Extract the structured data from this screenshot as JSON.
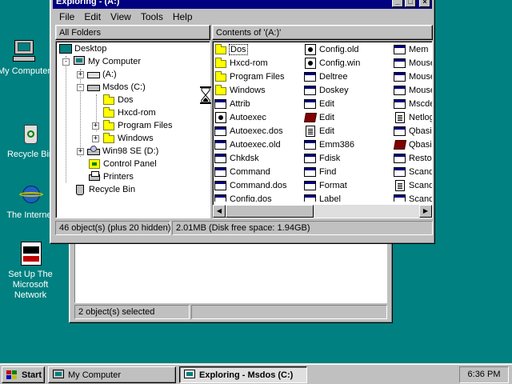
{
  "desktop": {
    "icons": [
      {
        "label": "My Computer",
        "icon": "my-computer-icon"
      },
      {
        "label": "Recycle Bin",
        "icon": "recycle-bin-icon"
      },
      {
        "label": "The Internet",
        "icon": "internet-explorer-icon"
      },
      {
        "label": "Set Up The Microsoft Network",
        "icon": "msn-icon"
      }
    ]
  },
  "explorer": {
    "title": "Exploring - (A:)",
    "menu": [
      "File",
      "Edit",
      "View",
      "Tools",
      "Help"
    ],
    "left_header": "All Folders",
    "right_header": "Contents of '(A:)'",
    "tree": [
      {
        "label": "Desktop",
        "icon": "desktop-icon"
      },
      {
        "label": "My Computer",
        "icon": "computer-icon",
        "expander": "-"
      },
      {
        "label": "(A:)",
        "icon": "floppy-drive-icon",
        "expander": "+"
      },
      {
        "label": "Msdos (C:)",
        "icon": "hard-drive-icon",
        "expander": "-"
      },
      {
        "label": "Dos",
        "icon": "folder-icon"
      },
      {
        "label": "Hxcd-rom",
        "icon": "folder-icon"
      },
      {
        "label": "Program Files",
        "icon": "folder-icon",
        "expander": "+"
      },
      {
        "label": "Windows",
        "icon": "folder-icon",
        "expander": "+"
      },
      {
        "label": "Win98 SE (D:)",
        "icon": "cd-drive-icon",
        "expander": "+"
      },
      {
        "label": "Control Panel",
        "icon": "control-panel-icon"
      },
      {
        "label": "Printers",
        "icon": "printer-icon"
      },
      {
        "label": "Recycle Bin",
        "icon": "recycle-bin-icon"
      }
    ],
    "files": [
      [
        {
          "name": "Dos",
          "icon": "folder-icon"
        },
        {
          "name": "Hxcd-rom",
          "icon": "folder-icon"
        },
        {
          "name": "Program Files",
          "icon": "folder-icon"
        },
        {
          "name": "Windows",
          "icon": "folder-icon"
        },
        {
          "name": "Attrib",
          "icon": "program-icon"
        },
        {
          "name": "Autoexec",
          "icon": "settings-file-icon"
        },
        {
          "name": "Autoexec.dos",
          "icon": "program-icon"
        },
        {
          "name": "Autoexec.old",
          "icon": "program-icon"
        },
        {
          "name": "Chkdsk",
          "icon": "program-icon"
        },
        {
          "name": "Command",
          "icon": "program-icon"
        },
        {
          "name": "Command.dos",
          "icon": "program-icon"
        },
        {
          "name": "Config.dos",
          "icon": "program-icon"
        }
      ],
      [
        {
          "name": "Config.old",
          "icon": "settings-file-icon"
        },
        {
          "name": "Config.win",
          "icon": "settings-file-icon"
        },
        {
          "name": "Deltree",
          "icon": "program-icon"
        },
        {
          "name": "Doskey",
          "icon": "program-icon"
        },
        {
          "name": "Edit",
          "icon": "program-icon"
        },
        {
          "name": "Edit",
          "icon": "help-book-icon"
        },
        {
          "name": "Edit",
          "icon": "text-document-icon"
        },
        {
          "name": "Emm386",
          "icon": "program-icon"
        },
        {
          "name": "Fdisk",
          "icon": "program-icon"
        },
        {
          "name": "Find",
          "icon": "program-icon"
        },
        {
          "name": "Format",
          "icon": "program-icon"
        },
        {
          "name": "Label",
          "icon": "program-icon"
        }
      ],
      [
        {
          "name": "Mem",
          "icon": "program-icon"
        },
        {
          "name": "Mouse",
          "icon": "program-icon"
        },
        {
          "name": "Mouse",
          "icon": "program-icon"
        },
        {
          "name": "Mouse",
          "icon": "program-icon"
        },
        {
          "name": "Mscde",
          "icon": "program-icon"
        },
        {
          "name": "Netlog",
          "icon": "text-document-icon"
        },
        {
          "name": "Qbasic",
          "icon": "program-icon"
        },
        {
          "name": "Qbasic",
          "icon": "help-book-icon"
        },
        {
          "name": "Restor",
          "icon": "program-icon"
        },
        {
          "name": "Scand",
          "icon": "program-icon"
        },
        {
          "name": "Scand",
          "icon": "text-document-icon"
        },
        {
          "name": "Scand",
          "icon": "program-icon"
        }
      ]
    ],
    "status_objects": "46 object(s) (plus 20 hidden)",
    "status_size": "2.01MB (Disk free space: 1.94GB)"
  },
  "background_window": {
    "status_selected": "2 object(s) selected"
  },
  "taskbar": {
    "start_label": "Start",
    "tasks": [
      {
        "label": "My Computer",
        "active": false
      },
      {
        "label": "Exploring - Msdos (C:)",
        "active": true
      }
    ],
    "clock": "6:36 PM"
  },
  "colors": {
    "desktop": "#008080",
    "titlebar": "#000080",
    "face": "#c0c0c0"
  }
}
